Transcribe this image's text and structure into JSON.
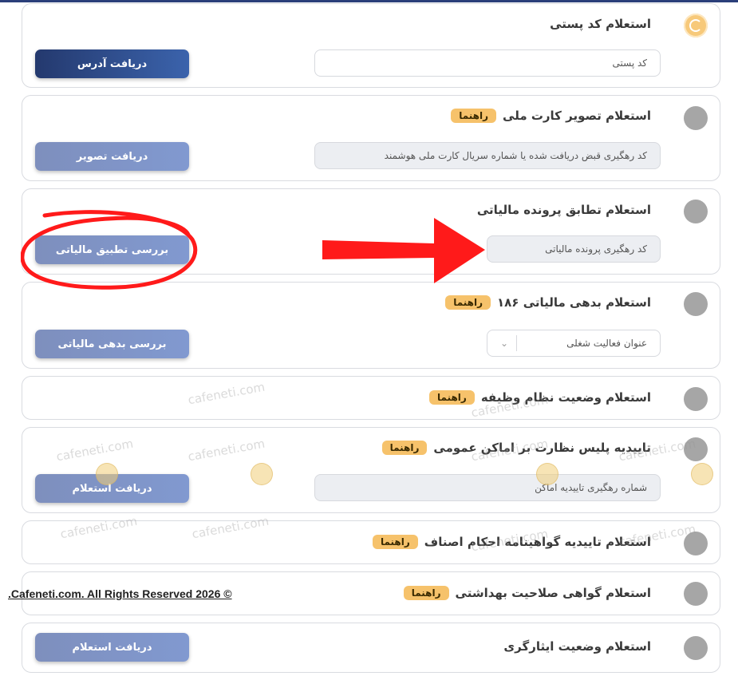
{
  "services": [
    {
      "title": "استعلام کد پستی",
      "field": "کد پستی",
      "button": "دریافت آدرس"
    },
    {
      "title": "استعلام تصویر کارت ملی",
      "guide": "راهنما",
      "field": "کد رهگیری قبض دریافت شده یا شماره سریال کارت  ملی هوشمند",
      "button": "دریافت تصویر"
    },
    {
      "title": "استعلام تطابق پرونده مالیاتی",
      "field": "کد رهگیری پرونده مالیاتی",
      "button": "بررسی تطبیق مالیاتی"
    },
    {
      "title": "استعلام بدهی مالیاتی ۱۸۶",
      "guide": "راهنما",
      "field": "عنوان فعالیت شغلی",
      "button": "بررسی بدهی مالیاتی"
    },
    {
      "title": "استعلام وضعیت نظام وظیفه",
      "guide": "راهنما"
    },
    {
      "title": "تاییدیه پلیس نظارت بر اماکن عمومی",
      "guide": "راهنما",
      "field": "شماره رهگیری تاییدیه اماکن",
      "button": "دریافت استعلام"
    },
    {
      "title": "استعلام تاییدیه گواهینامه احکام اصناف",
      "guide": "راهنما"
    },
    {
      "title": "استعلام گواهی صلاحیت بهداشتی",
      "guide": "راهنما"
    },
    {
      "title": "استعلام وضعیت ایثارگری",
      "button": "دریافت استعلام"
    }
  ],
  "watermark": {
    "text": "cafeneti.com"
  },
  "footer": {
    "copyright": ".Cafeneti.com. All Rights Reserved 2026 ©"
  },
  "icons": {
    "dropdown": "chevron-down-icon",
    "status": "status-dot-icon",
    "annotation_arrow": "red-arrow-icon",
    "annotation_circle": "red-circle-icon"
  },
  "colors": {
    "primary_button": "#2b4585",
    "secondary_button": "#8093c4",
    "guide_badge": "#f6c26b",
    "status_active": "#f7c97a",
    "status_inactive": "#a6a6a6",
    "annotation": "#ff1a1a"
  }
}
